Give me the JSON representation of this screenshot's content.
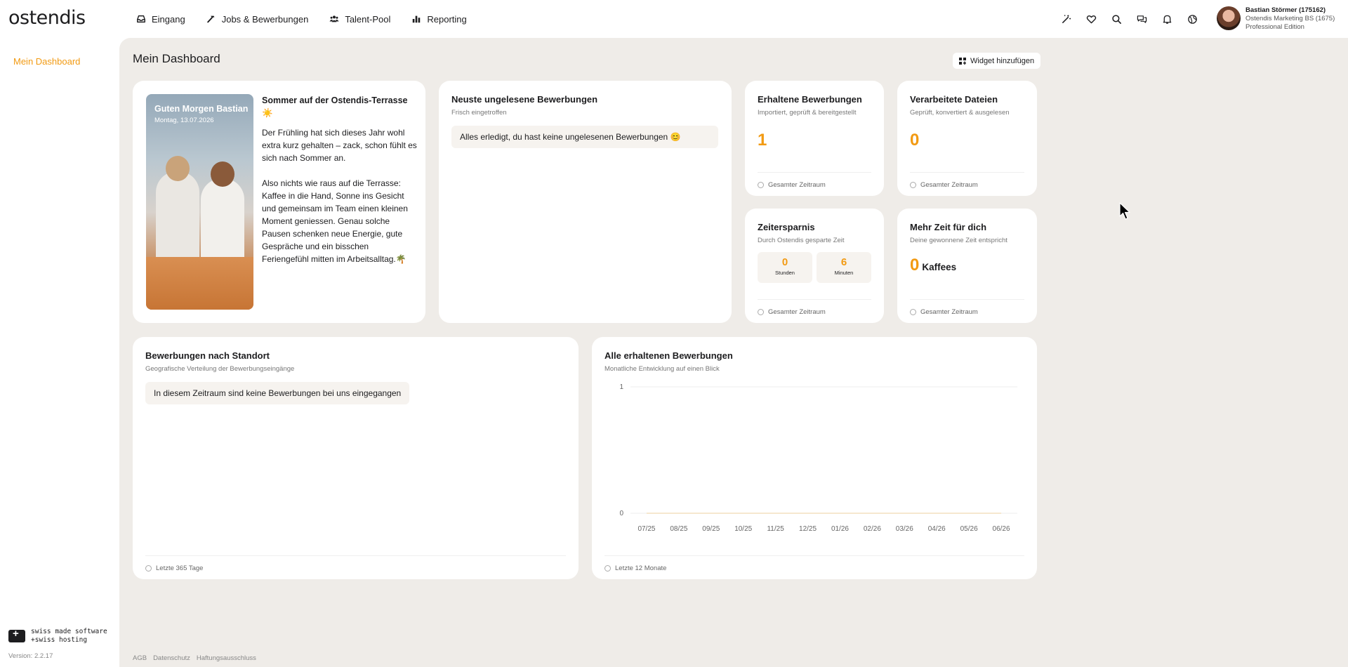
{
  "app": {
    "logo": "ostendis"
  },
  "nav": [
    {
      "label": "Eingang",
      "icon": "inbox-icon"
    },
    {
      "label": "Jobs & Bewerbungen",
      "icon": "hammer-icon"
    },
    {
      "label": "Talent-Pool",
      "icon": "people-icon"
    },
    {
      "label": "Reporting",
      "icon": "bar-chart-icon"
    }
  ],
  "user": {
    "name": "Bastian Störmer (175162)",
    "company": "Ostendis Marketing BS (1675)",
    "edition": "Professional Edition"
  },
  "sidebar": {
    "items": [
      {
        "label": "Mein Dashboard",
        "active": true
      }
    ],
    "swiss_line1": "swiss made software",
    "swiss_line2": "+swiss hosting",
    "version": "Version: 2.2.17"
  },
  "dashboard": {
    "title": "Mein Dashboard",
    "add_widget": "Widget hinzufügen",
    "welcome": {
      "greeting": "Guten Morgen Bastian",
      "date": "Montag, 13.07.2026",
      "title": "Sommer auf der Ostendis-Terrasse ☀️",
      "p1": "Der Frühling hat sich dieses Jahr wohl extra kurz gehalten – zack, schon fühlt es sich nach Sommer an.",
      "p2": "Also nichts wie raus auf die Terrasse: Kaffee in die Hand, Sonne ins Gesicht und gemeinsam im Team einen kleinen Moment geniessen. Genau solche Pausen schenken neue Energie, gute Gespräche und ein bisschen Feriengefühl mitten im Arbeitsalltag.🌴"
    },
    "unread": {
      "title": "Neuste ungelesene Bewerbungen",
      "subtitle": "Frisch eingetroffen",
      "message": "Alles erledigt, du hast keine ungelesenen Bewerbungen 😊"
    },
    "received": {
      "title": "Erhaltene Bewerbungen",
      "subtitle": "Importiert, geprüft & bereitgestellt",
      "value": "1",
      "footer": "Gesamter Zeitraum"
    },
    "files": {
      "title": "Verarbeitete Dateien",
      "subtitle": "Geprüft, konvertiert & ausgelesen",
      "value": "0",
      "footer": "Gesamter Zeitraum"
    },
    "savings": {
      "title": "Zeitersparnis",
      "subtitle": "Durch Ostendis gesparte Zeit",
      "hours_value": "0",
      "hours_label": "Stunden",
      "minutes_value": "6",
      "minutes_label": "Minuten",
      "footer": "Gesamter Zeitraum"
    },
    "more_time": {
      "title": "Mehr Zeit für dich",
      "subtitle": "Deine gewonnene Zeit entspricht",
      "value": "0",
      "unit": "Kaffees",
      "footer": "Gesamter Zeitraum"
    },
    "location": {
      "title": "Bewerbungen nach Standort",
      "subtitle": "Geografische Verteilung der Bewerbungseingänge",
      "message": "In diesem Zeitraum sind keine Bewerbungen bei uns eingegangen",
      "footer": "Letzte 365 Tage"
    },
    "all_apps": {
      "title": "Alle erhaltenen Bewerbungen",
      "subtitle": "Monatliche Entwicklung auf einen Blick",
      "footer": "Letzte 12 Monate"
    }
  },
  "footer_links": [
    "AGB",
    "Datenschutz",
    "Haftungsausschluss"
  ],
  "colors": {
    "accent": "#f29a12",
    "background": "#efece8"
  },
  "chart_data": {
    "type": "line",
    "title": "Alle erhaltenen Bewerbungen",
    "categories": [
      "07/25",
      "08/25",
      "09/25",
      "10/25",
      "11/25",
      "12/25",
      "01/26",
      "02/26",
      "03/26",
      "04/26",
      "05/26",
      "06/26"
    ],
    "series": [
      {
        "values": [
          0,
          0,
          0,
          0,
          0,
          0,
          0,
          0,
          0,
          0,
          0,
          0
        ]
      }
    ],
    "yticks": [
      0,
      1
    ],
    "ylim": [
      0,
      1
    ],
    "grid": true
  }
}
